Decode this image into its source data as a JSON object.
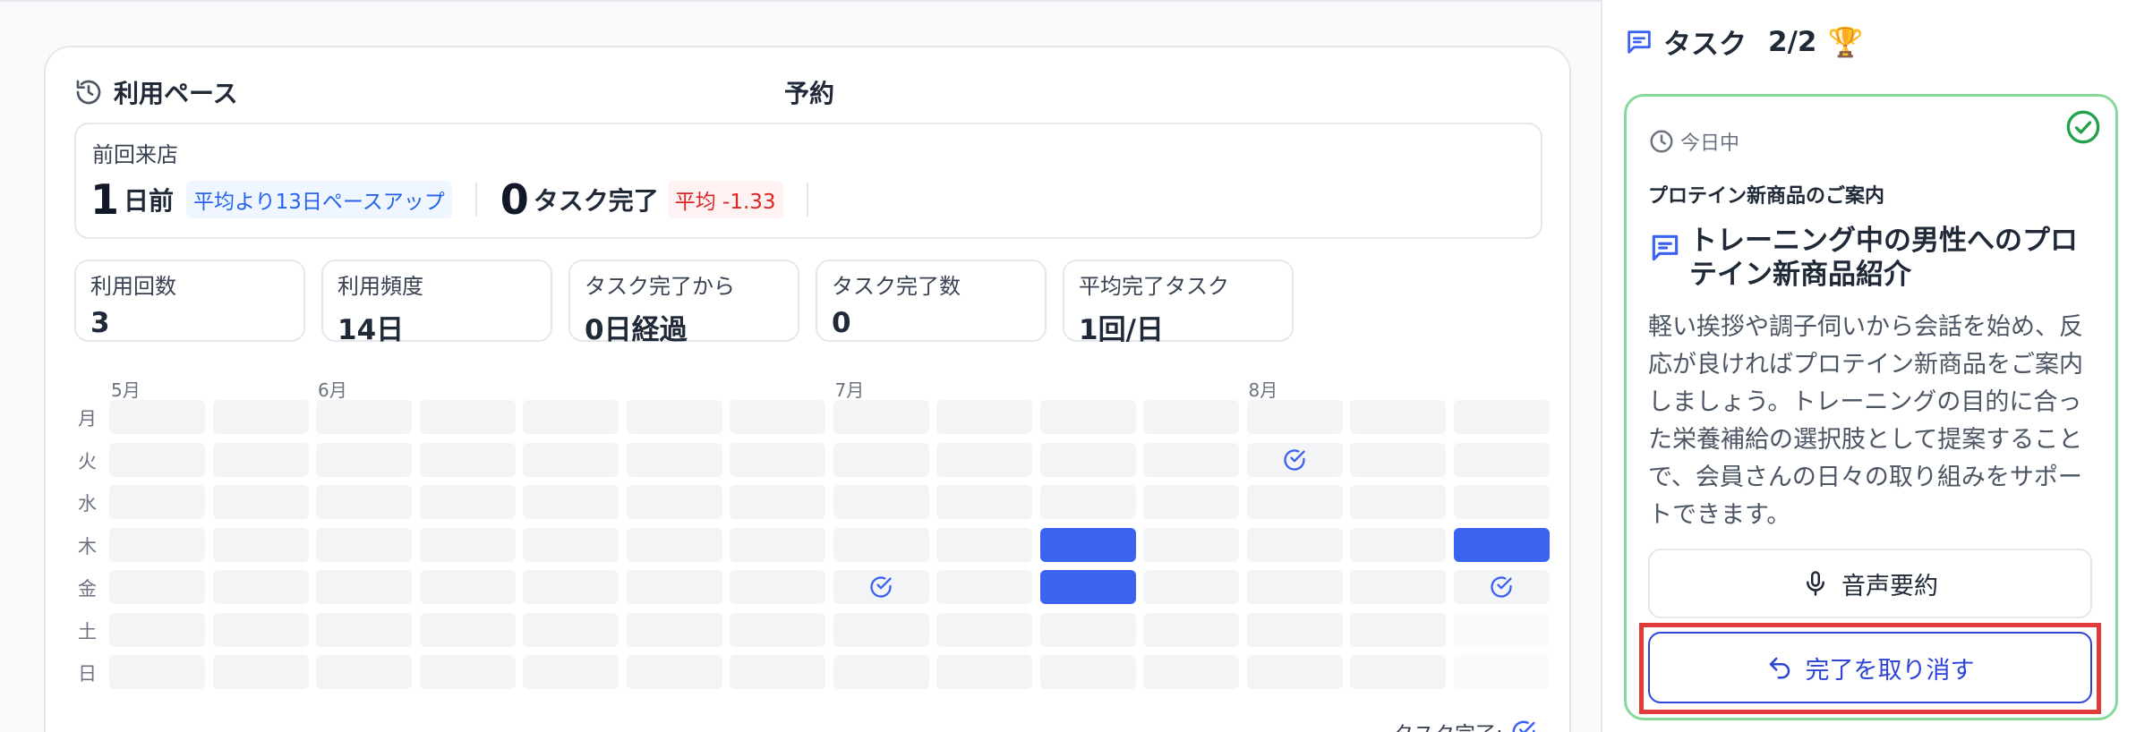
{
  "usage_card": {
    "title": "利用ペース",
    "center_title": "予約",
    "last_visit": {
      "label": "前回来店",
      "days_num": "1",
      "days_unit": "日前",
      "pace_badge": "平均より13日ペースアップ",
      "tasks_num": "0",
      "tasks_unit": "タスク完了",
      "avg_badge": "平均 -1.33"
    },
    "stats": [
      {
        "label": "利用回数",
        "value": "3"
      },
      {
        "label": "利用頻度",
        "value": "14日"
      },
      {
        "label": "タスク完了から",
        "value": "0日経過"
      },
      {
        "label": "タスク完了数",
        "value": "0"
      },
      {
        "label": "平均完了タスク",
        "value": "1回/日"
      }
    ]
  },
  "calendar": {
    "months": [
      "5月",
      "6月",
      "7月",
      "8月"
    ],
    "month_week_index": [
      0,
      2,
      7,
      11
    ],
    "days": [
      "月",
      "火",
      "水",
      "木",
      "金",
      "土",
      "日"
    ],
    "weeks": 14,
    "filled": [
      [
        3,
        9
      ],
      [
        4,
        9
      ],
      [
        3,
        13
      ]
    ],
    "checked": [
      [
        1,
        11
      ],
      [
        4,
        7
      ],
      [
        4,
        13
      ]
    ],
    "faint": [
      [
        5,
        13
      ],
      [
        6,
        13
      ]
    ],
    "legend_label": "タスク完了:"
  },
  "tasks": {
    "title": "タスク",
    "count": "2/2",
    "card": {
      "due": "今日中",
      "category": "プロテイン新商品のご案内",
      "name": "トレーニング中の男性へのプロテイン新商品紹介",
      "description": "軽い挨拶や調子伺いから会話を始め、反応が良ければプロテイン新商品をご案内しましょう。トレーニングの目的に合った栄養補給の選択肢として提案することで、会員さんの日々の取り組みをサポートできます。",
      "voice_button": "音声要約",
      "undo_button": "完了を取り消す"
    }
  },
  "colors": {
    "accent_blue": "#3b63f0",
    "complete_green": "#22a34a",
    "highlight_red": "#e03a3a"
  }
}
